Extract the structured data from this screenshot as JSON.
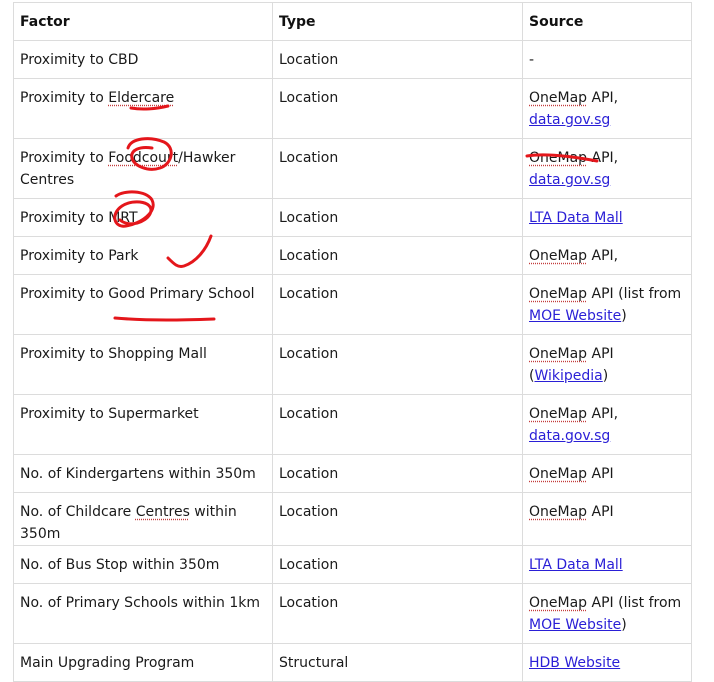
{
  "table": {
    "headers": {
      "factor": "Factor",
      "type": "Type",
      "source": "Source"
    },
    "rows": [
      {
        "factor": "Proximity to CBD",
        "type": "Location",
        "source_text": "-"
      },
      {
        "factor_prefix": "Proximity to ",
        "factor_spell": "Eldercare",
        "type": "Location",
        "source_prefix": "OneMap",
        "source_text": " API,",
        "source_link": "data.gov.sg"
      },
      {
        "factor_prefix": "Proximity to ",
        "factor_spell": "Foodcourt",
        "factor_suffix": "/Hawker Centres",
        "type": "Location",
        "source_prefix": "OneMap",
        "source_text": " API,",
        "source_link": "data.gov.sg"
      },
      {
        "factor": "Proximity to MRT",
        "type": "Location",
        "source_link": "LTA Data Mall"
      },
      {
        "factor": "Proximity to Park",
        "type": "Location",
        "source_prefix": "OneMap",
        "source_text": " API,"
      },
      {
        "factor": "Proximity to Good Primary School",
        "type": "Location",
        "source_prefix": "OneMap",
        "source_text": " API (list from",
        "source_link": "MOE Website",
        "source_suffix": ")"
      },
      {
        "factor": "Proximity to Shopping Mall",
        "type": "Location",
        "source_prefix": "OneMap",
        "source_text": " API",
        "source_before_link": "(",
        "source_link": "Wikipedia",
        "source_suffix": ")"
      },
      {
        "factor": "Proximity to Supermarket",
        "type": "Location",
        "source_prefix": "OneMap",
        "source_text": " API,",
        "source_link": "data.gov.sg"
      },
      {
        "factor": "No. of Kindergartens within 350m",
        "type": "Location",
        "source_prefix": "OneMap",
        "source_text": " API"
      },
      {
        "factor_prefix": "No. of Childcare ",
        "factor_spell": "Centres",
        "factor_suffix": " within 350m",
        "type": "Location",
        "source_prefix": "OneMap",
        "source_text": " API"
      },
      {
        "factor": "No. of Bus Stop within 350m",
        "type": "Location",
        "source_link": "LTA Data Mall"
      },
      {
        "factor": "No. of Primary Schools within 1km",
        "type": "Location",
        "source_prefix": "OneMap",
        "source_text": " API (list from",
        "source_link": "MOE Website",
        "source_suffix": ")"
      },
      {
        "factor": "Main Upgrading Program",
        "type": "Structural",
        "source_link": "HDB Website"
      }
    ]
  },
  "colors": {
    "link": "#2a1fd6",
    "annotation_ink": "#e4161b",
    "border": "#dcdcdc",
    "spellcheck": "#d8262b"
  }
}
